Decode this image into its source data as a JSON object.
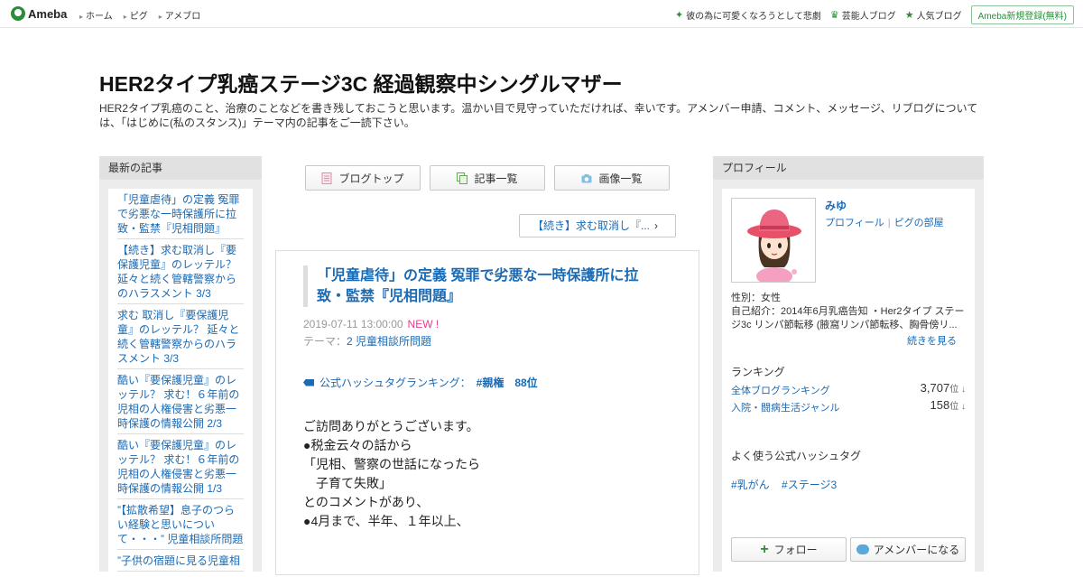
{
  "topbar": {
    "logo": "Ameba",
    "nav": [
      "ホーム",
      "ピグ",
      "アメブロ"
    ],
    "right_items": [
      {
        "icon": "sparkle-icon",
        "label": "彼の為に可愛くなろうとして悲劇"
      },
      {
        "icon": "crown-icon",
        "label": "芸能人ブログ"
      },
      {
        "icon": "star-icon",
        "label": "人気ブログ"
      }
    ],
    "register": "Ameba新規登録(無料)"
  },
  "header": {
    "title": "HER2タイプ乳癌ステージ3C 経過観察中シングルマザー",
    "description": "HER2タイプ乳癌のこと、治療のことなどを書き残しておこうと思います。温かい目で見守っていただければ、幸いです。アメンバー申請、コメント、メッセージ、リブログについては、「はじめに(私のスタンス)」テーマ内の記事をご一読下さい。"
  },
  "left": {
    "heading": "最新の記事",
    "items": [
      "「児童虐待」の定義 冤罪で劣悪な一時保護所に拉致・監禁『児相問題』",
      "【続き】求む取消し『要保護児童』のレッテル？ 延々と続く管轄警察からのハラスメント 3/3",
      "求む 取消し『要保護児童』のレッテル？ 延々と続く管轄警察からのハラスメント 3/3",
      "酷い『要保護児童』のレッテル？ 求む！６年前の児相の人権侵害と劣悪一時保護の情報公開 2/3",
      "酷い『要保護児童』のレッテル？ 求む！６年前の児相の人権侵害と劣悪一時保護の情報公開 1/3",
      "”【拡散希望】息子のつらい経験と思いについて・・・” 児童相談所問題",
      "”子供の宿題に見る児童相"
    ]
  },
  "center": {
    "nav": [
      {
        "icon": "document-icon",
        "label": "ブログトップ"
      },
      {
        "icon": "copy-icon",
        "label": "記事一覧"
      },
      {
        "icon": "camera-icon",
        "label": "画像一覧"
      }
    ],
    "next": "【続き】求む取消し『...",
    "article": {
      "title": "「児童虐待」の定義 冤罪で劣悪な一時保護所に拉致・監禁『児相問題』",
      "date": "2019-07-11 13:00:00",
      "new": "NEW !",
      "theme_label": "テーマ：",
      "theme": "2 児童相談所問題",
      "hashtag_label": "公式ハッシュタグランキング：",
      "hashtag": "#親権　88位",
      "body": [
        "ご訪問ありがとうございます。",
        "",
        "●税金云々の話から",
        "「児相、警察の世話になったら",
        "　子育て失敗」",
        "とのコメントがあり、",
        "",
        "●4月まで、半年、１年以上、"
      ]
    }
  },
  "right": {
    "heading": "プロフィール",
    "name": "みゆ",
    "link_profile": "プロフィール",
    "link_room": "ピグの部屋",
    "gender": "性別：女性",
    "intro": "自己紹介：2014年6月乳癌告知 ・Her2タイプ ステージ3c リンパ節転移 (腋窩リンパ節転移、胸骨傍リ...",
    "more": "続きを見る",
    "ranking_heading": "ランキング",
    "rankings": [
      {
        "label": "全体ブログランキング",
        "value": "3,707",
        "unit": "位 ↓"
      },
      {
        "label": "入院・闘病生活ジャンル",
        "value": "158",
        "unit": "位 ↓"
      }
    ],
    "tags_heading": "よく使う公式ハッシュタグ",
    "tags": [
      "#乳がん",
      "#ステージ3"
    ],
    "follow": "フォロー",
    "amember": "アメンバーになる"
  },
  "colors": {
    "accent": "#2d8c3c",
    "link": "#1a6ab4",
    "new": "#e63c8c"
  }
}
